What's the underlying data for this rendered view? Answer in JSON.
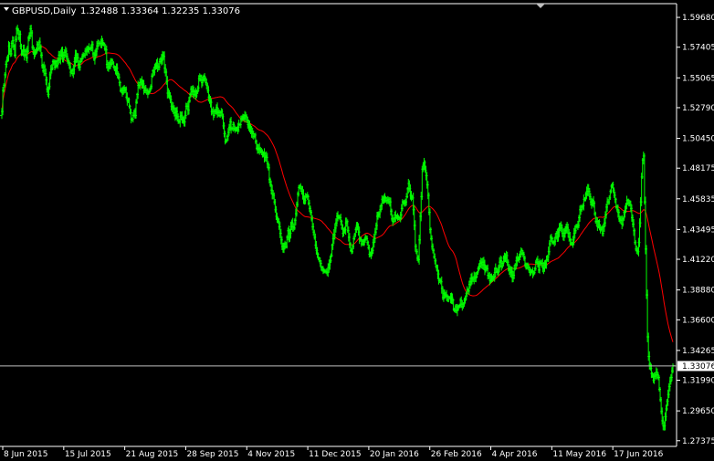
{
  "header": {
    "symbol_timeframe": "GBPUSD,Daily",
    "ohlc": "1.32488 1.33364 1.32235 1.33076"
  },
  "current_price_label": "1.33076",
  "colors": {
    "background": "#000000",
    "bars": "#00ff00",
    "moving_average": "#ff0000",
    "grid_text": "#ffffff",
    "price_line": "#c0c0c0",
    "price_box": "#ffffff"
  },
  "chart_data": {
    "type": "bar",
    "style": "ohlc",
    "title": "GBPUSD,Daily",
    "x_tick_labels": [
      "8 Jun 2015",
      "15 Jul 2015",
      "21 Aug 2015",
      "28 Sep 2015",
      "4 Nov 2015",
      "11 Dec 2015",
      "20 Jan 2016",
      "26 Feb 2016",
      "4 Apr 2016",
      "11 May 2016",
      "17 Jun 2016"
    ],
    "y_tick_labels": [
      "1.59680",
      "1.57405",
      "1.55065",
      "1.52790",
      "1.50450",
      "1.48175",
      "1.45835",
      "1.43495",
      "1.41220",
      "1.38880",
      "1.36600",
      "1.34265",
      "1.31990",
      "1.29650",
      "1.27375"
    ],
    "ylim": [
      1.2715,
      1.6045
    ],
    "current_price": 1.33076,
    "series": [
      {
        "kind": "ohlc",
        "color": "#00ff00",
        "close": [
          1.525,
          1.541,
          1.545,
          1.553,
          1.561,
          1.564,
          1.567,
          1.575,
          1.571,
          1.569,
          1.577,
          1.579,
          1.575,
          1.568,
          1.58,
          1.588,
          1.587,
          1.581,
          1.584,
          1.575,
          1.569,
          1.571,
          1.572,
          1.568,
          1.571,
          1.566,
          1.571,
          1.581,
          1.583,
          1.588,
          1.585,
          1.574,
          1.57,
          1.569,
          1.57,
          1.572,
          1.576,
          1.573,
          1.578,
          1.574,
          1.568,
          1.56,
          1.556,
          1.559,
          1.554,
          1.549,
          1.542,
          1.538,
          1.544,
          1.553,
          1.557,
          1.558,
          1.563,
          1.562,
          1.559,
          1.563,
          1.56,
          1.564,
          1.568,
          1.565,
          1.568,
          1.572,
          1.565,
          1.568,
          1.57,
          1.571,
          1.567,
          1.564,
          1.562,
          1.559,
          1.555,
          1.556,
          1.554,
          1.557,
          1.563,
          1.568,
          1.566,
          1.566,
          1.561,
          1.559,
          1.563,
          1.565,
          1.567,
          1.568,
          1.568,
          1.571,
          1.571,
          1.572,
          1.573,
          1.573,
          1.573,
          1.574,
          1.576,
          1.569,
          1.565,
          1.568,
          1.571,
          1.575,
          1.577,
          1.577,
          1.577,
          1.577,
          1.579,
          1.577,
          1.576,
          1.573,
          1.572,
          1.561,
          1.559,
          1.559,
          1.562,
          1.561,
          1.564,
          1.562,
          1.559,
          1.557,
          1.556,
          1.558,
          1.554,
          1.551,
          1.547,
          1.541,
          1.541,
          1.539,
          1.543,
          1.541,
          1.542,
          1.536,
          1.533,
          1.534,
          1.529,
          1.524,
          1.519,
          1.519,
          1.522,
          1.525,
          1.522,
          1.532,
          1.538,
          1.545,
          1.545,
          1.547,
          1.548,
          1.546,
          1.546,
          1.541,
          1.543,
          1.541,
          1.539,
          1.539,
          1.54,
          1.542,
          1.544,
          1.552,
          1.556,
          1.555,
          1.559,
          1.56,
          1.562,
          1.559,
          1.559,
          1.563,
          1.565,
          1.564,
          1.568,
          1.567,
          1.558,
          1.555,
          1.548,
          1.539,
          1.539,
          1.537,
          1.534,
          1.529,
          1.528,
          1.527,
          1.524,
          1.522,
          1.525,
          1.521,
          1.518,
          1.517,
          1.521,
          1.522,
          1.519,
          1.518,
          1.517,
          1.522,
          1.529,
          1.529,
          1.526,
          1.533,
          1.538,
          1.542,
          1.54,
          1.541,
          1.538,
          1.54,
          1.537,
          1.54,
          1.543,
          1.55,
          1.552,
          1.549,
          1.547,
          1.549,
          1.552,
          1.55,
          1.547,
          1.545,
          1.541,
          1.536,
          1.533,
          1.532,
          1.525,
          1.525,
          1.522,
          1.525,
          1.525,
          1.528,
          1.524,
          1.525,
          1.522,
          1.524,
          1.525,
          1.521,
          1.514,
          1.508,
          1.502,
          1.503,
          1.506,
          1.509,
          1.513,
          1.517,
          1.512,
          1.512,
          1.515,
          1.512,
          1.511,
          1.512,
          1.511,
          1.513,
          1.515,
          1.515,
          1.519,
          1.52,
          1.521,
          1.52,
          1.522,
          1.521,
          1.518,
          1.515,
          1.514,
          1.513,
          1.51,
          1.509,
          1.508,
          1.506,
          1.507,
          1.502,
          1.497,
          1.496,
          1.497,
          1.496,
          1.495,
          1.494,
          1.492,
          1.493,
          1.49,
          1.491,
          1.49,
          1.485,
          1.482,
          1.473,
          1.469,
          1.465,
          1.462,
          1.461,
          1.456,
          1.45,
          1.445,
          1.443,
          1.441,
          1.437,
          1.432,
          1.427,
          1.422,
          1.42,
          1.422,
          1.424,
          1.422,
          1.429,
          1.434,
          1.429,
          1.432,
          1.437,
          1.44,
          1.437,
          1.436,
          1.442,
          1.447,
          1.454,
          1.462,
          1.467,
          1.468,
          1.466,
          1.464,
          1.462,
          1.458,
          1.457,
          1.46,
          1.461,
          1.46,
          1.455,
          1.451,
          1.448,
          1.443,
          1.437,
          1.433,
          1.429,
          1.423,
          1.419,
          1.416,
          1.413,
          1.411,
          1.409,
          1.406,
          1.404,
          1.404,
          1.403,
          1.403,
          1.403,
          1.402,
          1.406,
          1.408,
          1.411,
          1.415,
          1.423,
          1.428,
          1.431,
          1.436,
          1.44,
          1.445,
          1.445,
          1.444,
          1.444,
          1.441,
          1.436,
          1.432,
          1.434,
          1.435,
          1.44,
          1.441,
          1.434,
          1.429,
          1.424,
          1.419,
          1.418,
          1.422,
          1.428,
          1.431,
          1.435,
          1.438,
          1.437,
          1.433,
          1.428,
          1.427,
          1.424,
          1.426,
          1.424,
          1.427,
          1.429,
          1.428,
          1.425,
          1.421,
          1.416,
          1.416,
          1.417,
          1.419,
          1.425,
          1.428,
          1.433,
          1.438,
          1.445,
          1.446,
          1.447,
          1.45,
          1.453,
          1.458,
          1.457,
          1.459,
          1.459,
          1.457,
          1.457,
          1.458,
          1.456,
          1.456,
          1.449,
          1.443,
          1.441,
          1.443,
          1.446,
          1.444,
          1.445,
          1.444,
          1.444,
          1.443,
          1.446,
          1.451,
          1.456,
          1.455,
          1.455,
          1.456,
          1.46,
          1.466,
          1.47,
          1.466,
          1.461,
          1.46,
          1.459,
          1.45,
          1.438,
          1.422,
          1.418,
          1.413,
          1.412,
          1.427,
          1.445,
          1.46,
          1.481,
          1.484,
          1.486,
          1.48,
          1.476,
          1.469,
          1.461,
          1.448,
          1.435,
          1.428,
          1.422,
          1.419,
          1.414,
          1.411,
          1.407,
          1.404,
          1.401,
          1.396,
          1.396,
          1.395,
          1.39,
          1.383,
          1.386,
          1.385,
          1.385,
          1.384,
          1.381,
          1.383,
          1.383,
          1.382,
          1.383,
          1.381,
          1.374,
          1.373,
          1.376,
          1.373,
          1.374,
          1.376,
          1.377,
          1.381,
          1.378,
          1.376,
          1.378,
          1.381,
          1.382,
          1.386,
          1.389,
          1.388,
          1.393,
          1.395,
          1.398,
          1.397,
          1.397,
          1.399,
          1.398,
          1.399,
          1.402,
          1.405,
          1.407,
          1.409,
          1.41,
          1.408,
          1.41,
          1.408,
          1.404,
          1.406,
          1.405,
          1.4,
          1.399,
          1.396,
          1.399,
          1.397,
          1.398,
          1.399,
          1.402,
          1.405,
          1.403,
          1.402,
          1.406,
          1.41,
          1.411,
          1.407,
          1.409,
          1.413,
          1.414,
          1.413,
          1.415,
          1.41,
          1.405,
          1.404,
          1.402,
          1.403,
          1.398,
          1.4,
          1.405,
          1.408,
          1.411,
          1.413,
          1.412,
          1.414,
          1.416,
          1.419,
          1.417,
          1.416,
          1.413,
          1.408,
          1.406,
          1.408,
          1.406,
          1.404,
          1.402,
          1.403,
          1.403,
          1.401,
          1.402,
          1.405,
          1.41,
          1.412,
          1.409,
          1.404,
          1.41,
          1.409,
          1.409,
          1.406,
          1.405,
          1.409,
          1.408,
          1.412,
          1.414,
          1.418,
          1.424,
          1.429,
          1.428,
          1.425,
          1.425,
          1.426,
          1.429,
          1.432,
          1.429,
          1.433,
          1.436,
          1.438,
          1.436,
          1.432,
          1.43,
          1.432,
          1.434,
          1.437,
          1.436,
          1.432,
          1.429,
          1.427,
          1.424,
          1.424,
          1.427,
          1.432,
          1.434,
          1.437,
          1.438,
          1.438,
          1.444,
          1.45,
          1.45,
          1.452,
          1.453,
          1.458,
          1.458,
          1.462,
          1.464,
          1.466,
          1.464,
          1.46,
          1.456,
          1.454,
          1.457,
          1.455,
          1.447,
          1.441,
          1.441,
          1.437,
          1.441,
          1.436,
          1.435,
          1.436,
          1.432,
          1.437,
          1.44,
          1.446,
          1.452,
          1.456,
          1.456,
          1.459,
          1.464,
          1.468,
          1.469,
          1.465,
          1.461,
          1.458,
          1.452,
          1.45,
          1.448,
          1.443,
          1.442,
          1.442,
          1.439,
          1.443,
          1.448,
          1.449,
          1.454,
          1.457,
          1.455,
          1.456,
          1.454,
          1.451,
          1.444,
          1.439,
          1.434,
          1.425,
          1.42,
          1.419,
          1.418,
          1.425,
          1.44,
          1.456,
          1.475,
          1.488,
          1.491,
          1.456,
          1.42,
          1.385,
          1.353,
          1.338,
          1.332,
          1.329,
          1.325,
          1.323,
          1.32,
          1.323,
          1.324,
          1.326,
          1.324,
          1.322,
          1.313,
          1.305,
          1.296,
          1.289,
          1.285,
          1.285,
          1.292,
          1.298,
          1.304,
          1.309,
          1.315,
          1.319,
          1.322,
          1.327,
          1.331
        ]
      },
      {
        "kind": "line",
        "color": "#ff0000",
        "note": "moving average (approx.)"
      }
    ]
  }
}
